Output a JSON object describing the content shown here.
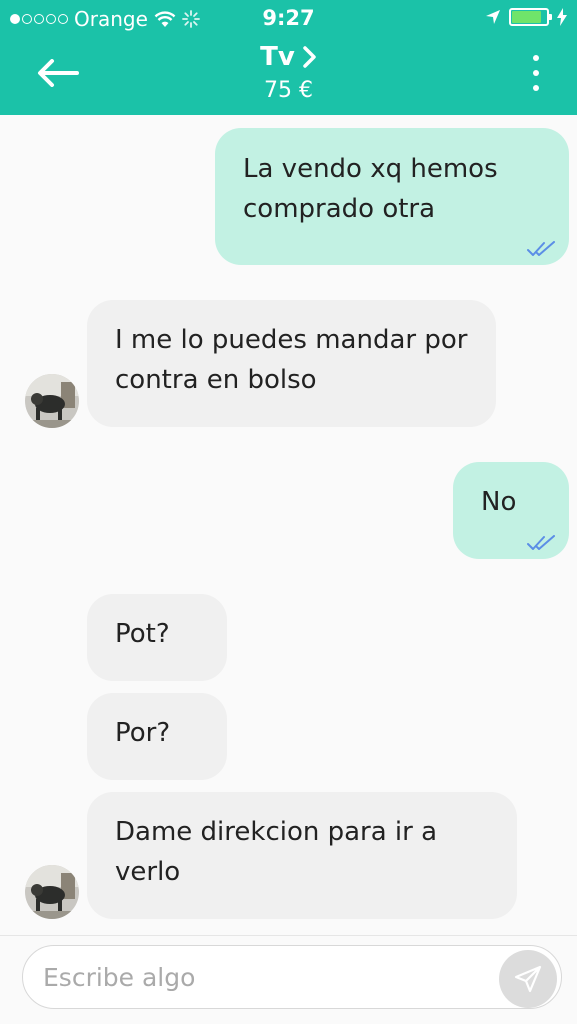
{
  "status_bar": {
    "carrier": "Orange",
    "time": "9:27",
    "battery_color": "#6fe46a"
  },
  "header": {
    "title": "Tv",
    "price": "75 €",
    "background_color": "#1bc2a8"
  },
  "messages": [
    {
      "direction": "sent",
      "text": "La vendo xq hemos comprado otra",
      "read_status": "double-check"
    },
    {
      "direction": "received",
      "text": "I me lo puedes mandar por contra en bolso"
    },
    {
      "direction": "sent",
      "text": "No",
      "read_status": "double-check"
    },
    {
      "direction": "received",
      "text": "Pot?"
    },
    {
      "direction": "received",
      "text": "Por?"
    },
    {
      "direction": "received",
      "text": "Dame direkcion para ir a verlo"
    }
  ],
  "composer": {
    "placeholder": "Escribe algo",
    "send_icon": "send-icon"
  },
  "colors": {
    "sent_bubble": "#c2f1e3",
    "received_bubble": "#f0f0f0",
    "check_color": "#5b8ee6"
  }
}
